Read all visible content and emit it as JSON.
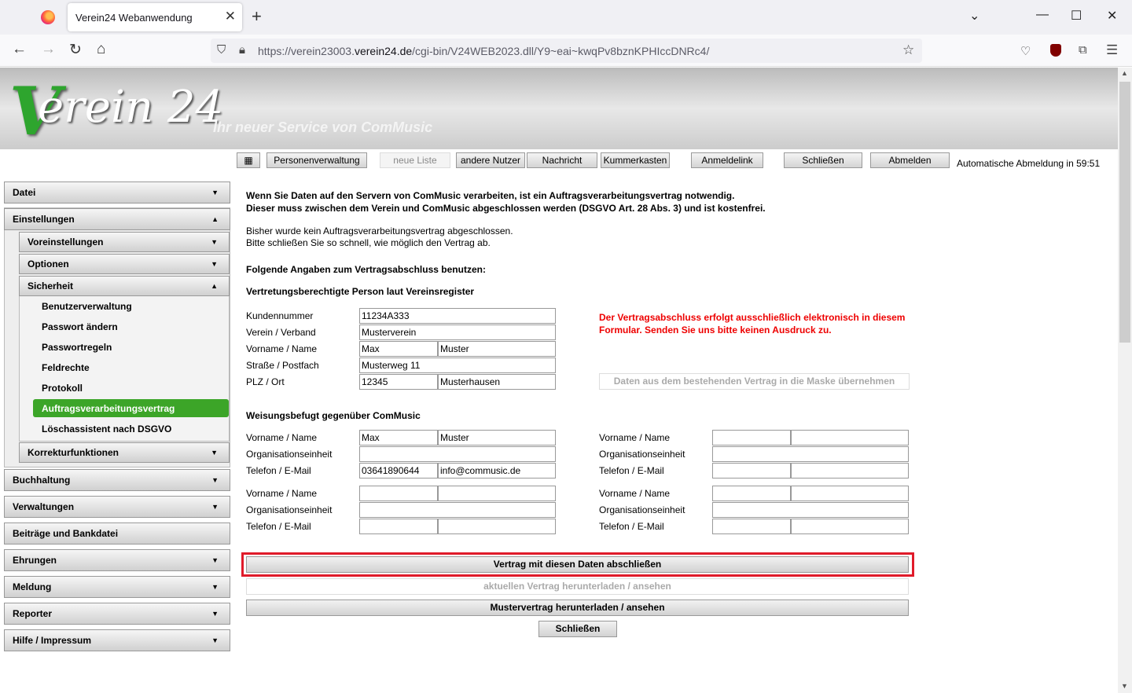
{
  "browser": {
    "tab_title": "Verein24 Webanwendung",
    "url_prefix": "https://verein23003.",
    "url_domain": "verein24.de",
    "url_suffix": "/cgi-bin/V24WEB2023.dll/Y9~eai~kwqPv8bznKPHIccDNRc4/"
  },
  "header": {
    "logo_v": "V",
    "logo_rest": "erein 24",
    "slogan": "Ihr neuer Service von ComMusic"
  },
  "toolbar": {
    "menu_icon": "▦",
    "personenverwaltung": "Personenverwaltung",
    "neue_liste": "neue Liste",
    "andere_nutzer": "andere Nutzer",
    "nachricht": "Nachricht",
    "kummerkasten": "Kummerkasten",
    "anmeldelink": "Anmeldelink",
    "schliessen": "Schließen",
    "abmelden": "Abmelden",
    "auto_logout": "Automatische Abmeldung in 59:51"
  },
  "sidebar": {
    "datei": "Datei",
    "einstellungen": "Einstellungen",
    "voreinstellungen": "Voreinstellungen",
    "optionen": "Optionen",
    "sicherheit": "Sicherheit",
    "links": [
      "Benutzerverwaltung",
      "Passwort ändern",
      "Passwortregeln",
      "Feldrechte",
      "Protokoll",
      "Auftragsverarbeitungsvertrag",
      "Löschassistent nach DSGVO"
    ],
    "korrekturfunktionen": "Korrekturfunktionen",
    "buchhaltung": "Buchhaltung",
    "verwaltungen": "Verwaltungen",
    "beitraege": "Beiträge und Bankdatei",
    "ehrungen": "Ehrungen",
    "meldung": "Meldung",
    "reporter": "Reporter",
    "hilfe": "Hilfe / Impressum",
    "arrow_down": "▼",
    "arrow_up": "▲"
  },
  "main": {
    "intro1": "Wenn Sie Daten auf den Servern von ComMusic verarbeiten, ist ein Auftragsverarbeitungsvertrag notwendig.",
    "intro2": "Dieser muss zwischen dem Verein und ComMusic abgeschlossen werden (DSGVO Art. 28 Abs. 3) und ist kostenfrei.",
    "status1": "Bisher wurde kein Auftragsverarbeitungsvertrag abgeschlossen.",
    "status2": "Bitte schließen Sie so schnell, wie möglich den Vertrag ab.",
    "folgende": "Folgende Angaben zum Vertragsabschluss benutzen:",
    "vertretung": "Vertretungsberechtigte Person laut Vereinsregister",
    "labels": {
      "kundennummer": "Kundennummer",
      "verein": "Verein / Verband",
      "name": "Vorname / Name",
      "strasse": "Straße / Postfach",
      "plz": "PLZ / Ort",
      "org": "Organisationseinheit",
      "tel": "Telefon / E-Mail"
    },
    "values": {
      "kundennummer": "11234A333",
      "verein": "Musterverein",
      "vorname": "Max",
      "name": "Muster",
      "strasse": "Musterweg 11",
      "plz": "12345",
      "ort": "Musterhausen",
      "w_vorname": "Max",
      "w_name": "Muster",
      "w_tel": "03641890644",
      "w_email": "info@commusic.de"
    },
    "red_note": "Der Vertragsabschluss erfolgt ausschließlich elektronisch in diesem Formular. Senden Sie uns bitte keinen Ausdruck zu.",
    "daten_uebernehmen": "Daten aus dem bestehenden Vertrag in die Maske übernehmen",
    "weisungsbefugt": "Weisungsbefugt gegenüber ComMusic",
    "btn_abschliessen": "Vertrag mit diesen Daten abschließen",
    "btn_aktuell": "aktuellen Vertrag herunterladen / ansehen",
    "btn_muster": "Mustervertrag herunterladen / ansehen",
    "btn_schliessen": "Schließen"
  }
}
